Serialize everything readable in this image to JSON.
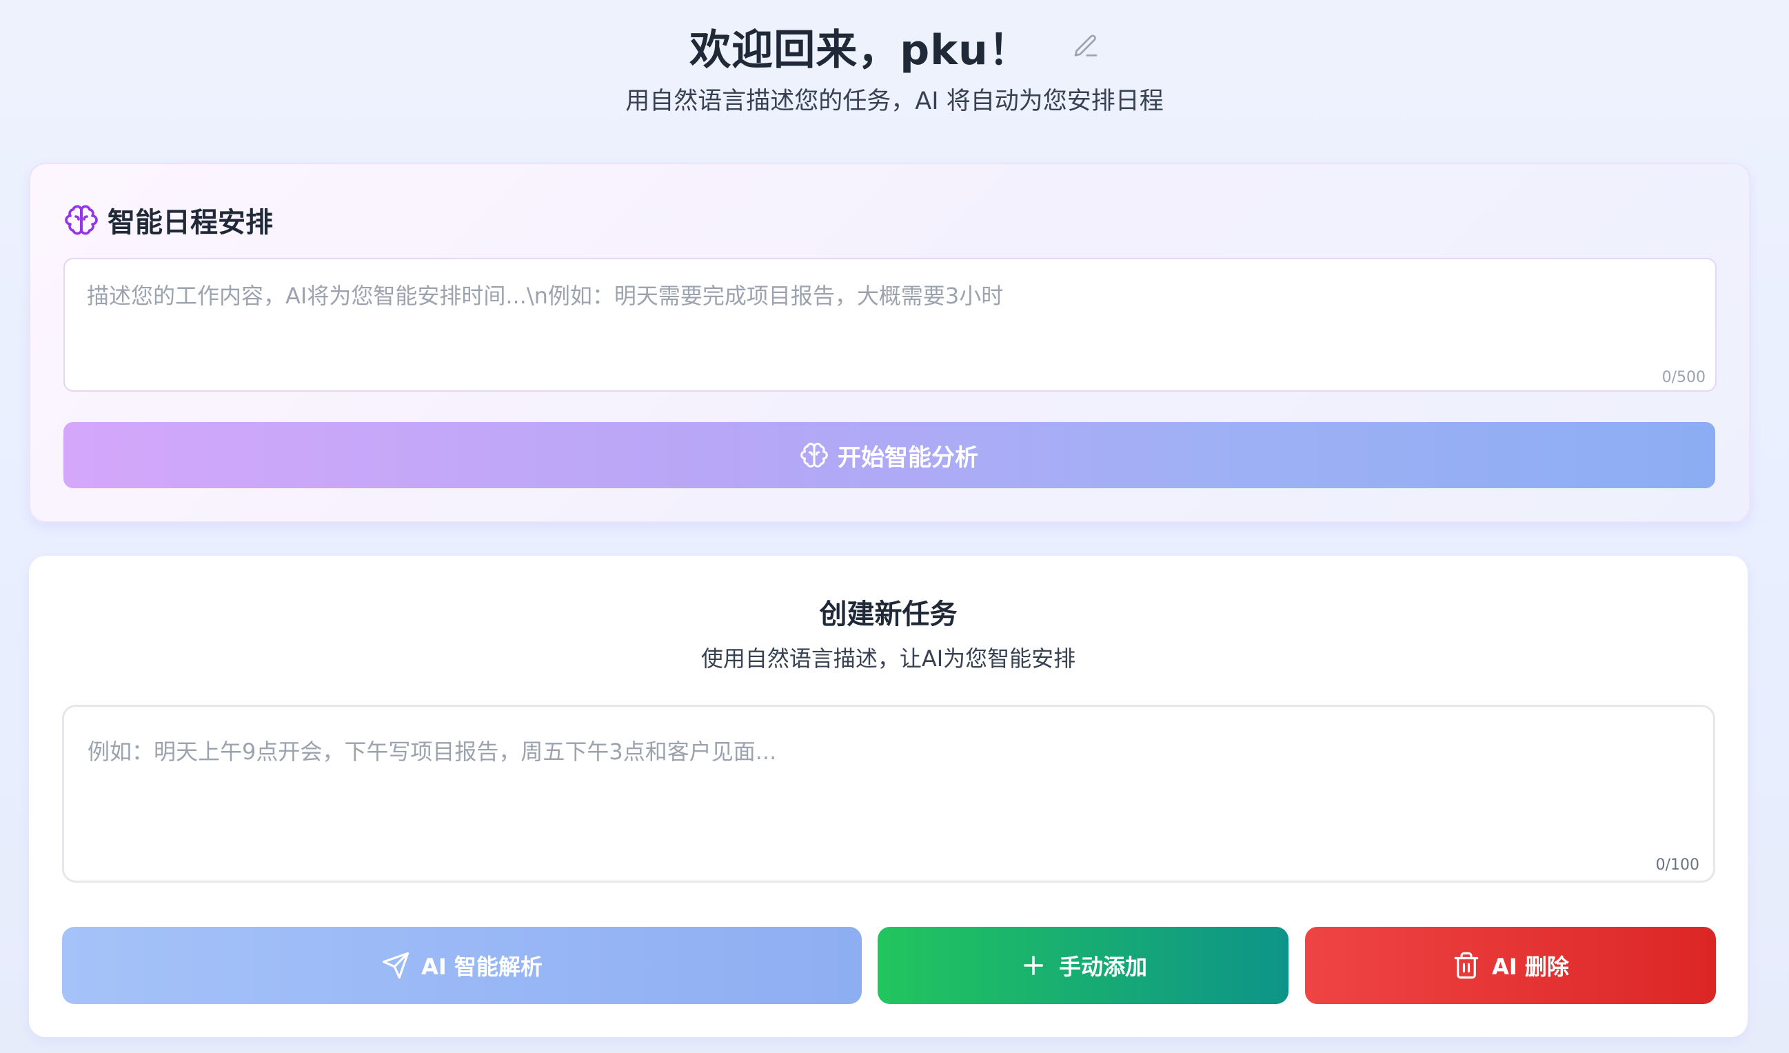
{
  "header": {
    "title": "欢迎回来，pku！",
    "subtitle": "用自然语言描述您的任务，AI 将自动为您安排日程"
  },
  "smart_schedule": {
    "title": "智能日程安排",
    "input": {
      "placeholder": "描述您的工作内容，AI将为您智能安排时间...\\n例如：明天需要完成项目报告，大概需要3小时",
      "value": "",
      "counter": "0/500"
    },
    "analyze_button": "开始智能分析"
  },
  "create_task": {
    "title": "创建新任务",
    "subtitle": "使用自然语言描述，让AI为您智能安排",
    "input": {
      "placeholder": "例如：明天上午9点开会，下午写项目报告，周五下午3点和客户见面...",
      "value": "",
      "counter": "0/100"
    },
    "buttons": {
      "ai_parse": "AI 智能解析",
      "manual_add": "手动添加",
      "ai_delete": "AI 删除"
    }
  },
  "icons": {
    "edit": "pencil-icon",
    "brain": "brain-icon",
    "send": "send-icon",
    "plus": "plus-icon",
    "trash": "trash-icon"
  },
  "colors": {
    "brain_purple": "#9333ea",
    "manual_green": "#22c55e",
    "manual_teal": "#0d9488",
    "delete_red": "#ef4444",
    "ai_blue": "#8eaef2"
  }
}
